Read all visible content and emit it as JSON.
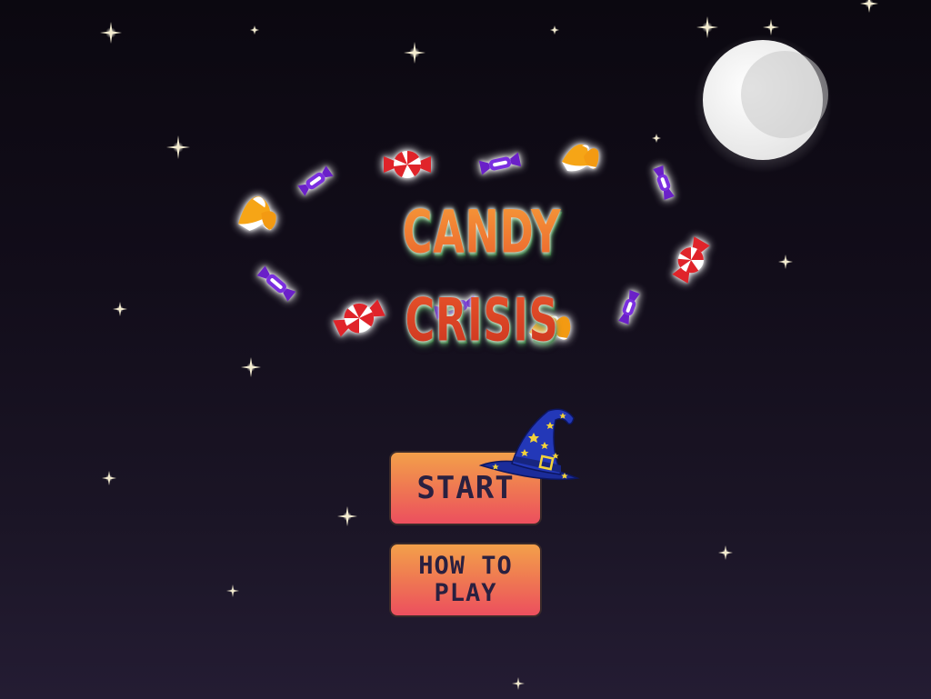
{
  "game": {
    "title": "CANDY CRISIS"
  },
  "menu": {
    "start_label": "START",
    "how_to_play_label": "HOW TO PLAY"
  },
  "colors": {
    "sky_top": "#0b0810",
    "sky_bottom": "#241c33",
    "title_gradient_top": "#f7a13a",
    "title_gradient_bottom": "#c8301e",
    "title_shadow": "#1f6a2a",
    "button_top": "#f3a04a",
    "button_bottom": "#ec4f5e",
    "button_text": "#2a2040",
    "hat_blue": "#2338b8",
    "star_yellow": "#f2d23a"
  },
  "decorations": {
    "candies": [
      "candy-corn",
      "wrapped-candy",
      "peppermint"
    ],
    "icons": [
      "moon-icon",
      "wizard-hat-icon",
      "twinkling-star-icon"
    ]
  }
}
